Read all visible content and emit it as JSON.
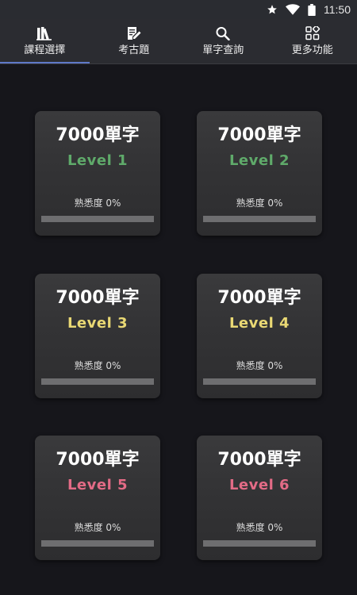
{
  "status_bar": {
    "time": "11:50",
    "icons": [
      "star-icon",
      "wifi-icon",
      "battery-icon"
    ]
  },
  "tabs": [
    {
      "label": "課程選擇",
      "icon": "books-icon",
      "active": true
    },
    {
      "label": "考古題",
      "icon": "edit-note-icon",
      "active": false
    },
    {
      "label": "單字查詢",
      "icon": "search-icon",
      "active": false
    },
    {
      "label": "更多功能",
      "icon": "apps-icon",
      "active": false
    }
  ],
  "colors": {
    "accent": "#5f79c8",
    "level_green": "#5faa6a",
    "level_yellow": "#e9d874",
    "level_pink": "#e36b86"
  },
  "cards": [
    {
      "title": "7000單字",
      "level": "Level  1",
      "level_color": "#5faa6a",
      "progress_text": "熟悉度 0%",
      "progress": 0
    },
    {
      "title": "7000單字",
      "level": "Level  2",
      "level_color": "#5faa6a",
      "progress_text": "熟悉度 0%",
      "progress": 0
    },
    {
      "title": "7000單字",
      "level": "Level  3",
      "level_color": "#e9d874",
      "progress_text": "熟悉度 0%",
      "progress": 0
    },
    {
      "title": "7000單字",
      "level": "Level  4",
      "level_color": "#e9d874",
      "progress_text": "熟悉度 0%",
      "progress": 0
    },
    {
      "title": "7000單字",
      "level": "Level  5",
      "level_color": "#e36b86",
      "progress_text": "熟悉度 0%",
      "progress": 0
    },
    {
      "title": "7000單字",
      "level": "Level  6",
      "level_color": "#e36b86",
      "progress_text": "熟悉度 0%",
      "progress": 0
    }
  ]
}
